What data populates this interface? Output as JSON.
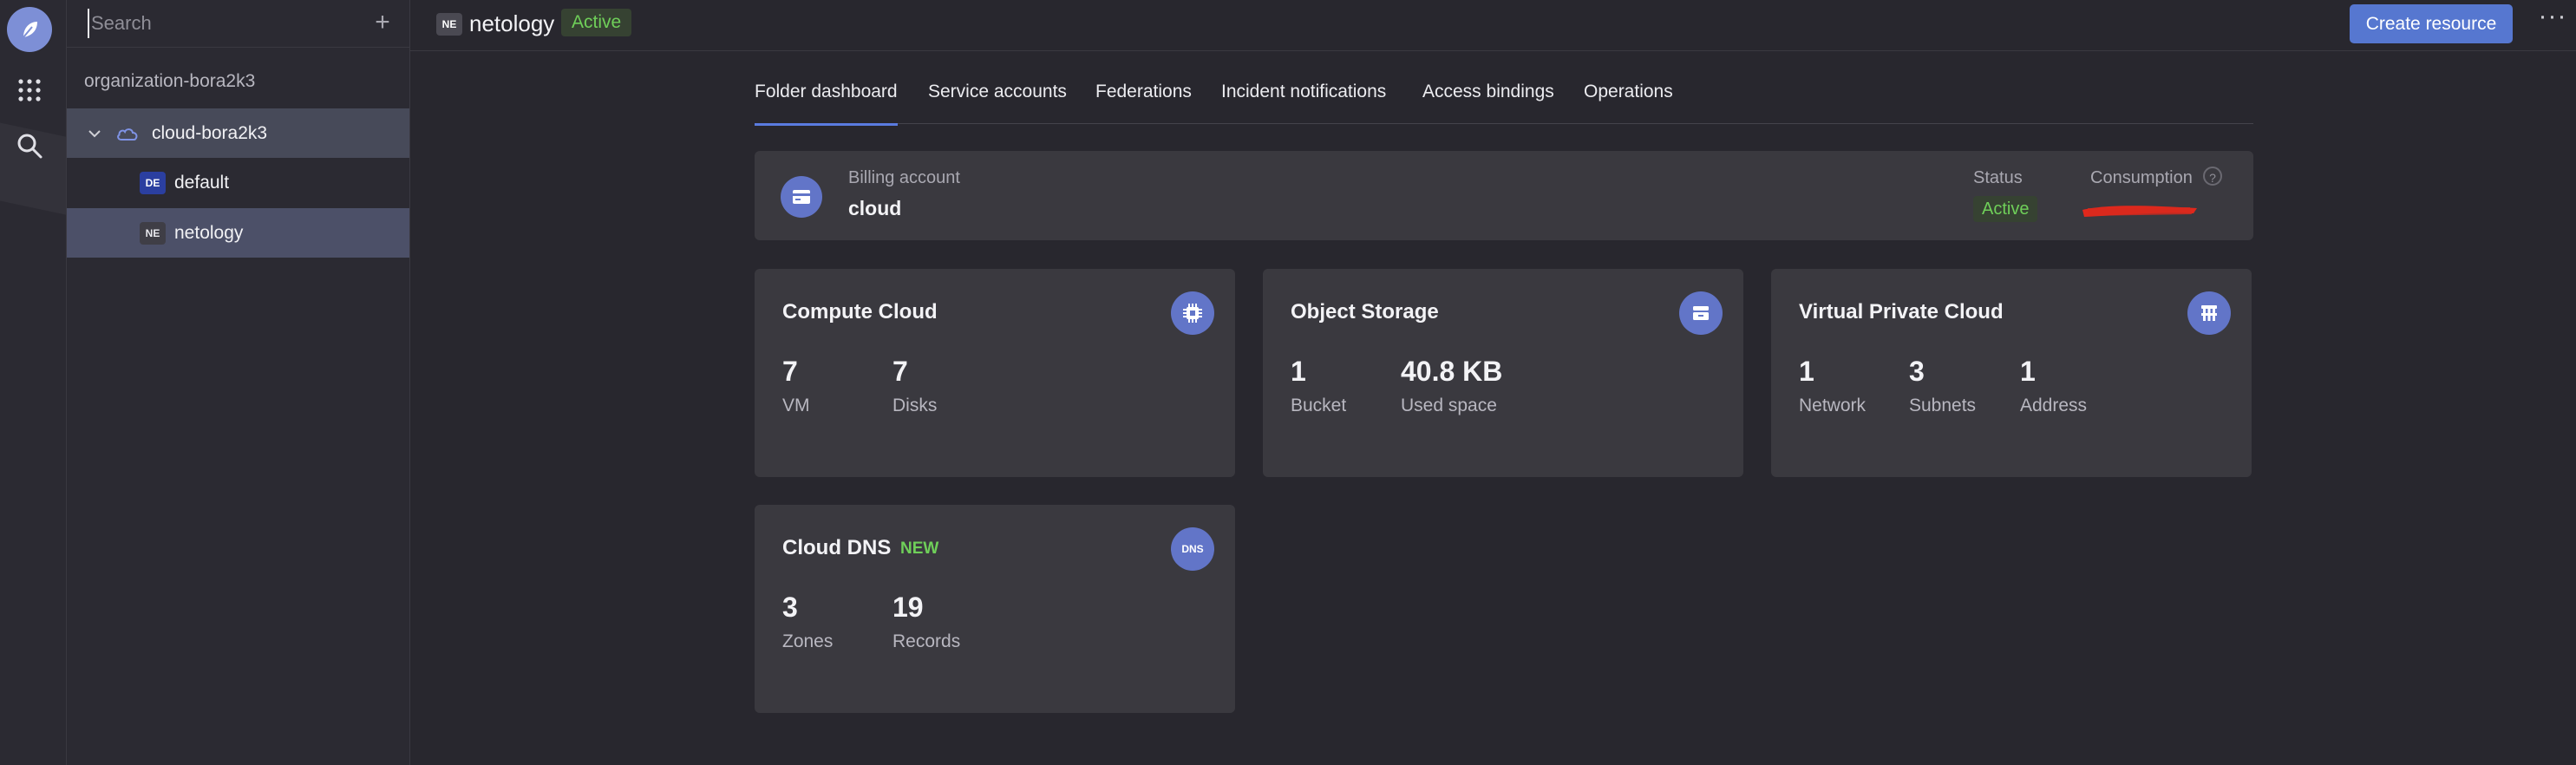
{
  "sidebar": {
    "search_placeholder": "Search",
    "organization": "organization-bora2k3",
    "cloud": {
      "label": "cloud-bora2k3"
    },
    "folders": [
      {
        "badge": "DE",
        "label": "default"
      },
      {
        "badge": "NE",
        "label": "netology"
      }
    ]
  },
  "header": {
    "badge": "NE",
    "title": "netology",
    "status": "Active",
    "create_button": "Create resource",
    "more": "···"
  },
  "tabs": [
    {
      "label": "Folder dashboard",
      "active": true
    },
    {
      "label": "Service accounts"
    },
    {
      "label": "Federations"
    },
    {
      "label": "Incident notifications"
    },
    {
      "label": "Access bindings"
    },
    {
      "label": "Operations"
    }
  ],
  "billing": {
    "label": "Billing account",
    "value": "cloud",
    "status_label": "Status",
    "status_value": "Active",
    "consumption_label": "Consumption",
    "help": "?"
  },
  "cards": {
    "compute": {
      "title": "Compute Cloud",
      "metrics": [
        {
          "value": "7",
          "label": "VM"
        },
        {
          "value": "7",
          "label": "Disks"
        }
      ]
    },
    "storage": {
      "title": "Object Storage",
      "metrics": [
        {
          "value": "1",
          "label": "Bucket"
        },
        {
          "value": "40.8 KB",
          "label": "Used space"
        }
      ]
    },
    "vpc": {
      "title": "Virtual Private Cloud",
      "metrics": [
        {
          "value": "1",
          "label": "Network"
        },
        {
          "value": "3",
          "label": "Subnets"
        },
        {
          "value": "1",
          "label": "Address"
        }
      ]
    },
    "dns": {
      "title": "Cloud DNS",
      "tag": "NEW",
      "icon_text": "DNS",
      "metrics": [
        {
          "value": "3",
          "label": "Zones"
        },
        {
          "value": "19",
          "label": "Records"
        }
      ]
    }
  },
  "colors": {
    "accent": "#5677d0",
    "active_green": "#6fcf59",
    "background": "#28272e",
    "card": "#3a393f",
    "selection": "#4c5068"
  },
  "icons": [
    "logo-icon",
    "apps-grid-icon",
    "search-icon",
    "plus-icon",
    "chevron-down-icon",
    "cloud-icon",
    "credit-card-icon",
    "chip-icon",
    "storage-icon",
    "network-icon",
    "question-icon",
    "more-icon"
  ]
}
